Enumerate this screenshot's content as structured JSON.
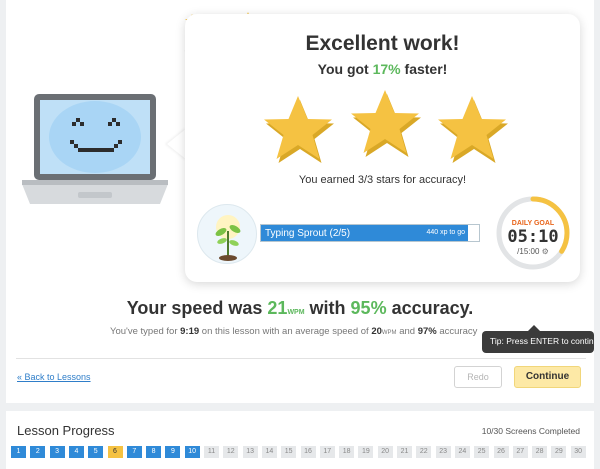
{
  "result": {
    "title": "Excellent work!",
    "sub_prefix": "You got ",
    "sub_percent": "17%",
    "sub_suffix": " faster!",
    "stars_text": "You earned 3/3 stars for accuracy!",
    "stars_earned": 3,
    "stars_total": 3
  },
  "xp": {
    "label": "Typing Sprout (2/5)",
    "right_text": "440 xp to go",
    "progress": 0.95
  },
  "daily_goal": {
    "label": "DAILY GOAL",
    "time": "05:10",
    "goal": "/15:00",
    "progress": 0.34
  },
  "speed": {
    "prefix": "Your speed was ",
    "wpm": "21",
    "wpm_unit": "WPM",
    "middle": " with ",
    "accuracy": "95%",
    "suffix": " accuracy."
  },
  "typed": {
    "part1": "You've typed for ",
    "time": "9:19",
    "part2": " on this lesson with an average speed of ",
    "avg": "20",
    "unit": "WPM",
    "part3": " and ",
    "acc": "97%",
    "part4": " accuracy"
  },
  "tooltip": "Tip: Press ENTER to continue",
  "actions": {
    "back": "« Back to Lessons",
    "redo": "Redo",
    "continue": "Continue"
  },
  "lesson_progress": {
    "title": "Lesson Progress",
    "completed_text": "10/30 Screens Completed",
    "cells": [
      {
        "n": "1",
        "s": "done"
      },
      {
        "n": "2",
        "s": "done"
      },
      {
        "n": "3",
        "s": "done"
      },
      {
        "n": "4",
        "s": "done"
      },
      {
        "n": "5",
        "s": "done"
      },
      {
        "n": "6",
        "s": "cur"
      },
      {
        "n": "7",
        "s": "done"
      },
      {
        "n": "8",
        "s": "done"
      },
      {
        "n": "9",
        "s": "done"
      },
      {
        "n": "10",
        "s": "done"
      },
      {
        "n": "11",
        "s": "todo"
      },
      {
        "n": "12",
        "s": "todo"
      },
      {
        "n": "13",
        "s": "todo"
      },
      {
        "n": "14",
        "s": "todo"
      },
      {
        "n": "15",
        "s": "todo"
      },
      {
        "n": "16",
        "s": "todo"
      },
      {
        "n": "17",
        "s": "todo"
      },
      {
        "n": "18",
        "s": "todo"
      },
      {
        "n": "19",
        "s": "todo"
      },
      {
        "n": "20",
        "s": "todo"
      },
      {
        "n": "21",
        "s": "todo"
      },
      {
        "n": "22",
        "s": "todo"
      },
      {
        "n": "23",
        "s": "todo"
      },
      {
        "n": "24",
        "s": "todo"
      },
      {
        "n": "25",
        "s": "todo"
      },
      {
        "n": "26",
        "s": "todo"
      },
      {
        "n": "27",
        "s": "todo"
      },
      {
        "n": "28",
        "s": "todo"
      },
      {
        "n": "29",
        "s": "todo"
      },
      {
        "n": "30",
        "s": "todo"
      }
    ]
  },
  "colors": {
    "accent_blue": "#2f8ad8",
    "accent_green": "#5cb85c",
    "star_yellow": "#f5c242",
    "goal_orange": "#e8651b"
  },
  "icons": [
    "laptop-mascot-icon",
    "star-icon",
    "sprout-icon",
    "gear-icon"
  ]
}
